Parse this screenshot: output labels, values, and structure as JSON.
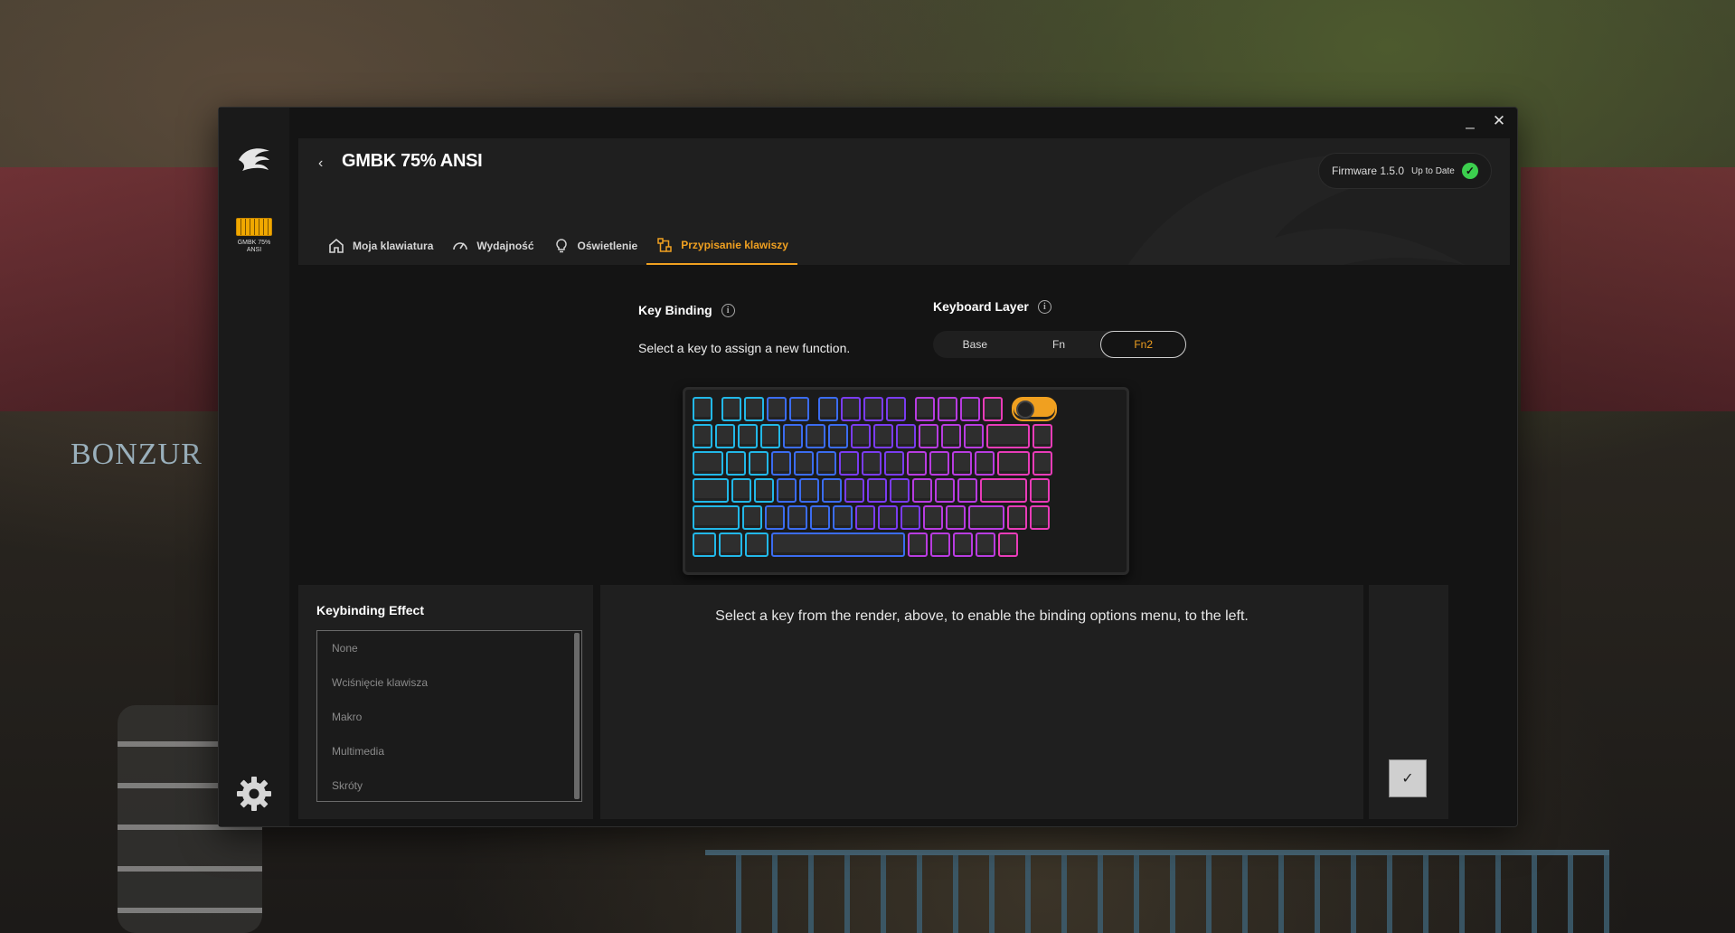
{
  "window": {
    "minimize_label": "_",
    "close_label": "✕"
  },
  "sidebar": {
    "device_label": "GMBK 75% ANSI"
  },
  "header": {
    "back_label": "‹",
    "title": "GMBK 75% ANSI",
    "firmware": "Firmware 1.5.0",
    "firmware_status": "Up to Date"
  },
  "tabs": [
    {
      "label": "Moja klawiatura",
      "icon": "home-icon"
    },
    {
      "label": "Wydajność",
      "icon": "gauge-icon"
    },
    {
      "label": "Oświetlenie",
      "icon": "lightbulb-icon"
    },
    {
      "label": "Przypisanie klawiszy",
      "icon": "keymap-icon",
      "active": true
    }
  ],
  "key_binding": {
    "title": "Key Binding",
    "subtitle": "Select a key to assign a new function."
  },
  "keyboard_layer": {
    "title": "Keyboard Layer",
    "options": [
      "Base",
      "Fn",
      "Fn2"
    ],
    "selected": "Fn2"
  },
  "keybinding_effect": {
    "title": "Keybinding Effect",
    "items": [
      "None",
      "Wciśnięcie klawisza",
      "Makro",
      "Multimedia",
      "Skróty"
    ]
  },
  "main_message": "Select a key from the render, above, to enable the binding options menu, to the left.",
  "confirm_label": "✓",
  "colors": {
    "accent": "#f0a020",
    "success": "#3ccf4e",
    "rgb_gradient": [
      "#22b8e8",
      "#3b6cf0",
      "#7a3cf0",
      "#b83ce0",
      "#e83cb8",
      "#f0285a"
    ]
  }
}
